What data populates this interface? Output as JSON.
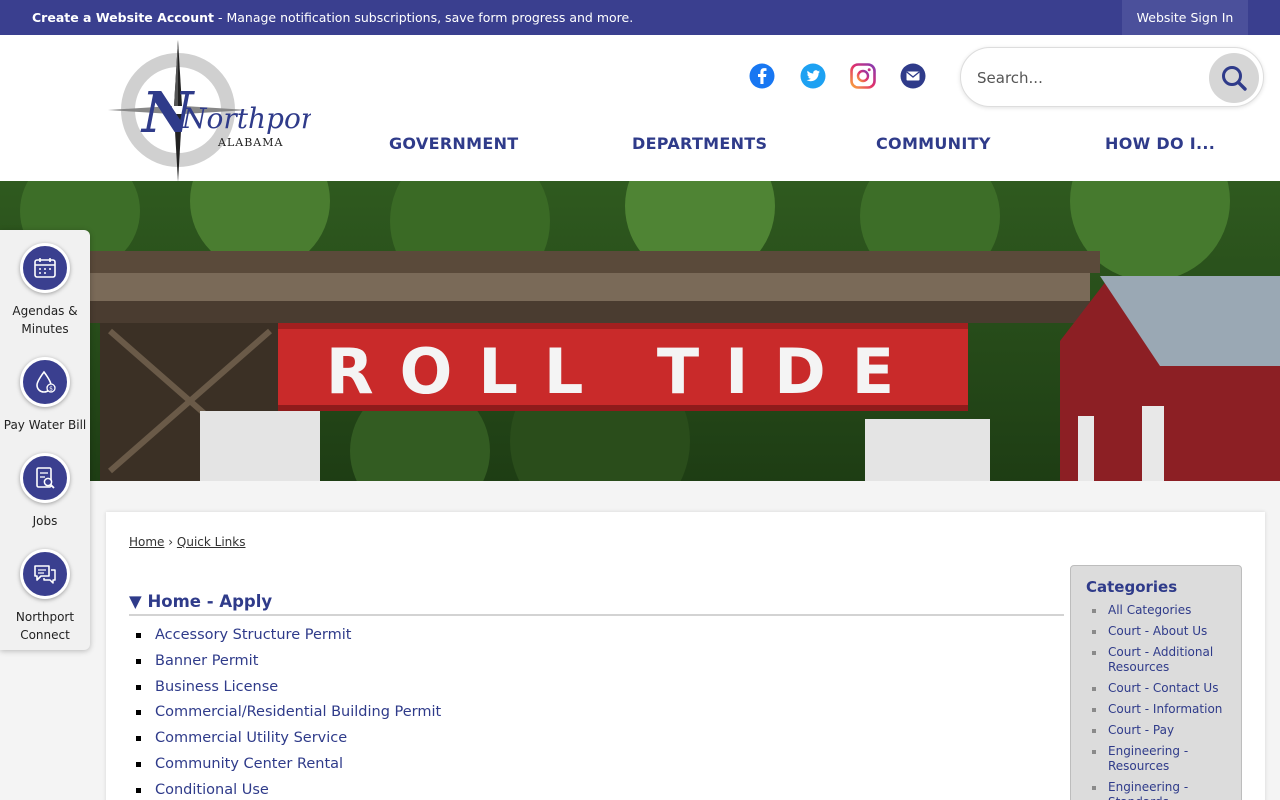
{
  "topbar": {
    "account_link": "Create a Website Account",
    "account_desc": " - Manage notification subscriptions, save form progress and more.",
    "sign_in": "Website Sign In"
  },
  "logo": {
    "name": "Northport",
    "state": "ALABAMA"
  },
  "social": [
    {
      "icon": "facebook-icon",
      "color": "#1877f2"
    },
    {
      "icon": "twitter-icon",
      "color": "#1da1f2"
    },
    {
      "icon": "instagram-icon",
      "color": "#c13584"
    },
    {
      "icon": "email-icon",
      "color": "#2f3b8a"
    }
  ],
  "search": {
    "placeholder": "Search..."
  },
  "nav": [
    "GOVERNMENT",
    "DEPARTMENTS",
    "COMMUNITY",
    "HOW DO I..."
  ],
  "banner": {
    "sign_text": "ROLL TIDE"
  },
  "rail": [
    {
      "label": "Agendas & Minutes",
      "icon": "calendar-icon"
    },
    {
      "label": "Pay Water Bill",
      "icon": "water-drop-icon"
    },
    {
      "label": "Jobs",
      "icon": "document-search-icon"
    },
    {
      "label": "Northport Connect",
      "icon": "chat-icon"
    }
  ],
  "breadcrumb": {
    "home": "Home",
    "sep": "›",
    "current": "Quick Links"
  },
  "section": {
    "arrow": "▼",
    "title": "Home - Apply"
  },
  "links": [
    "Accessory Structure Permit",
    "Banner Permit",
    "Business License",
    "Commercial/Residential Building Permit",
    "Commercial Utility Service",
    "Community Center Rental",
    "Conditional Use"
  ],
  "categories": {
    "title": "Categories",
    "items": [
      "All Categories",
      "Court - About Us",
      "Court - Additional Resources",
      "Court - Contact Us",
      "Court - Information",
      "Court - Pay",
      "Engineering - Resources",
      "Engineering - Standards"
    ]
  },
  "colors": {
    "brand": "#3a3f8f",
    "nav_text": "#2f3b8a",
    "sign_red": "#c92a2a"
  }
}
